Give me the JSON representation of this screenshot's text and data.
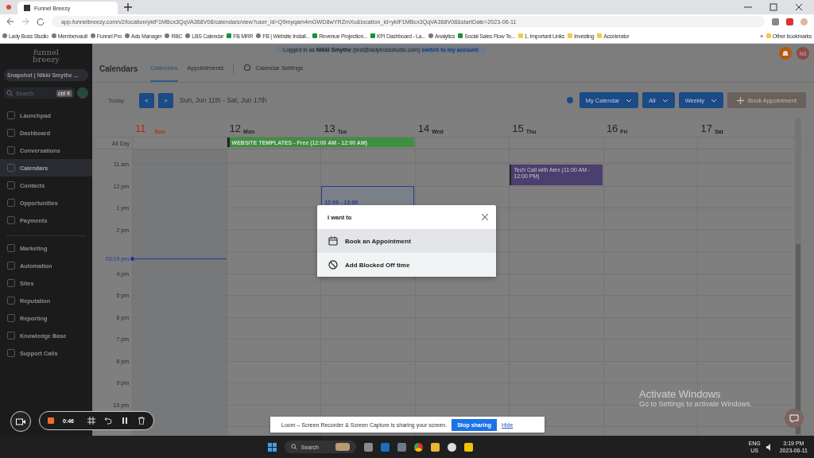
{
  "browser": {
    "tabs": [
      {
        "title": "Funnel Breezy",
        "selected": true
      }
    ],
    "url": "app.funnelbreezy.com/v2/location/yktF1MBcx3QqVA368V08/calendars/view?user_id=Q9myqam4mGWD8wYRZmXu&location_id=yktF1MBcx3QqVA368V08&startDate=2023-06-11",
    "bookmarks": [
      {
        "label": "Lady Boss Studio",
        "kind": "site"
      },
      {
        "label": "Membervault",
        "kind": "site"
      },
      {
        "label": "Funnel Pro",
        "kind": "site"
      },
      {
        "label": "Ads Manager",
        "kind": "site"
      },
      {
        "label": "RBC",
        "kind": "site"
      },
      {
        "label": "LBS Calendar",
        "kind": "site"
      },
      {
        "label": "FB MRR",
        "kind": "sheet"
      },
      {
        "label": "FB | Website Install...",
        "kind": "site"
      },
      {
        "label": "Revenue Projection...",
        "kind": "sheet"
      },
      {
        "label": "KPI Dashboard - La...",
        "kind": "sheet"
      },
      {
        "label": "Analytics",
        "kind": "site"
      },
      {
        "label": "Social Sales Flow Te...",
        "kind": "sheet"
      },
      {
        "label": "1. Important Links",
        "kind": "folder"
      },
      {
        "label": "Investing",
        "kind": "folder"
      },
      {
        "label": "Accelerator",
        "kind": "folder"
      }
    ],
    "more": "»",
    "other_bookmarks": "Other bookmarks"
  },
  "sidebar": {
    "logo": [
      "funnel",
      "breezy"
    ],
    "account": "Snapshot | Nikki Smythe ...",
    "search": {
      "placeholder": "Search",
      "shortcut": "ctrl K"
    },
    "groups": [
      [
        {
          "label": "Launchpad",
          "selected": false
        },
        {
          "label": "Dashboard",
          "selected": false
        },
        {
          "label": "Conversations",
          "selected": false
        },
        {
          "label": "Calendars",
          "selected": true
        },
        {
          "label": "Contacts",
          "selected": false
        },
        {
          "label": "Opportunities",
          "selected": false
        },
        {
          "label": "Payments",
          "selected": false
        }
      ],
      [
        {
          "label": "Marketing",
          "selected": false
        },
        {
          "label": "Automation",
          "selected": false
        },
        {
          "label": "Sites",
          "selected": false
        },
        {
          "label": "Reputation",
          "selected": false
        },
        {
          "label": "Reporting",
          "selected": false
        },
        {
          "label": "Knowledge Base",
          "selected": false
        },
        {
          "label": "Support Calls",
          "selected": false
        }
      ]
    ]
  },
  "header": {
    "banner": "Logged in as **Nikki Smythe** (test@ladybossstudio.com)",
    "banner_link": "switch to my account",
    "avatar": "NS",
    "title": "Calendars",
    "tabs": [
      {
        "label": "Calendars",
        "selected": true
      },
      {
        "label": "Appointments",
        "selected": false
      },
      {
        "label": "Calendar Settings",
        "selected": false
      }
    ]
  },
  "toolbar": {
    "today": "Today",
    "prev": "<",
    "next": ">",
    "range": "Sun, Jun 11th - Sat, Jun 17th",
    "dropdowns": [
      "My Calendar",
      "All",
      "Weekly"
    ],
    "book": "Book Appointment"
  },
  "calendar": {
    "all_day_label": "All Day",
    "days": [
      {
        "num": "11",
        "name": "Sun",
        "today": true
      },
      {
        "num": "12",
        "name": "Mon",
        "today": false,
        "all_day": {
          "title": "WEBSITE TEMPLATES - Free (12:00 AM - 12:00 AM)",
          "color": "#3f8f3f",
          "multi_day": true
        }
      },
      {
        "num": "13",
        "name": "Tue",
        "today": false,
        "events": [
          {
            "kind": "selection",
            "title": "12:00 - 13:00"
          }
        ]
      },
      {
        "num": "14",
        "name": "Wed",
        "today": false
      },
      {
        "num": "15",
        "name": "Thu",
        "today": false,
        "events": [
          {
            "kind": "event",
            "title": "Tech Call with Alex (11:00 AM - 12:00 PM)",
            "color": "#4a3f6e"
          }
        ]
      },
      {
        "num": "16",
        "name": "Fri",
        "today": false
      },
      {
        "num": "17",
        "name": "Sat",
        "today": false
      }
    ],
    "rows": [
      {
        "kind": "hour",
        "label": "11 am"
      },
      {
        "kind": "hour",
        "label": "12 pm"
      },
      {
        "kind": "hour",
        "label": "1 pm"
      },
      {
        "kind": "hour",
        "label": "2 pm"
      },
      {
        "kind": "now",
        "label": "03:19 pm"
      },
      {
        "kind": "hour",
        "label": "4 pm"
      },
      {
        "kind": "hour",
        "label": "5 pm"
      },
      {
        "kind": "hour",
        "label": "6 pm"
      },
      {
        "kind": "hour",
        "label": "7 pm"
      },
      {
        "kind": "hour",
        "label": "8 pm"
      },
      {
        "kind": "hour",
        "label": "9 pm"
      },
      {
        "kind": "hour",
        "label": "10 pm"
      }
    ]
  },
  "modal": {
    "title": "I want to",
    "options": [
      {
        "label": "Book an Appointment",
        "kind": "calendar",
        "selected": true
      },
      {
        "label": "Add Blocked Off time",
        "kind": "blocked",
        "selected": false
      }
    ]
  },
  "recorder": {
    "timer": "0:46"
  },
  "sharing": {
    "text": "Loom – Screen Recorder & Screen Capture is sharing your screen.",
    "button": "Stop sharing",
    "link": "Hide"
  },
  "watermark": {
    "title": "Activate Windows",
    "subtitle": "Go to Settings to activate Windows."
  },
  "taskbar": {
    "search": "Search",
    "lang": [
      "ENG",
      "US"
    ],
    "time": "3:19 PM",
    "date": "2023-06-11"
  }
}
